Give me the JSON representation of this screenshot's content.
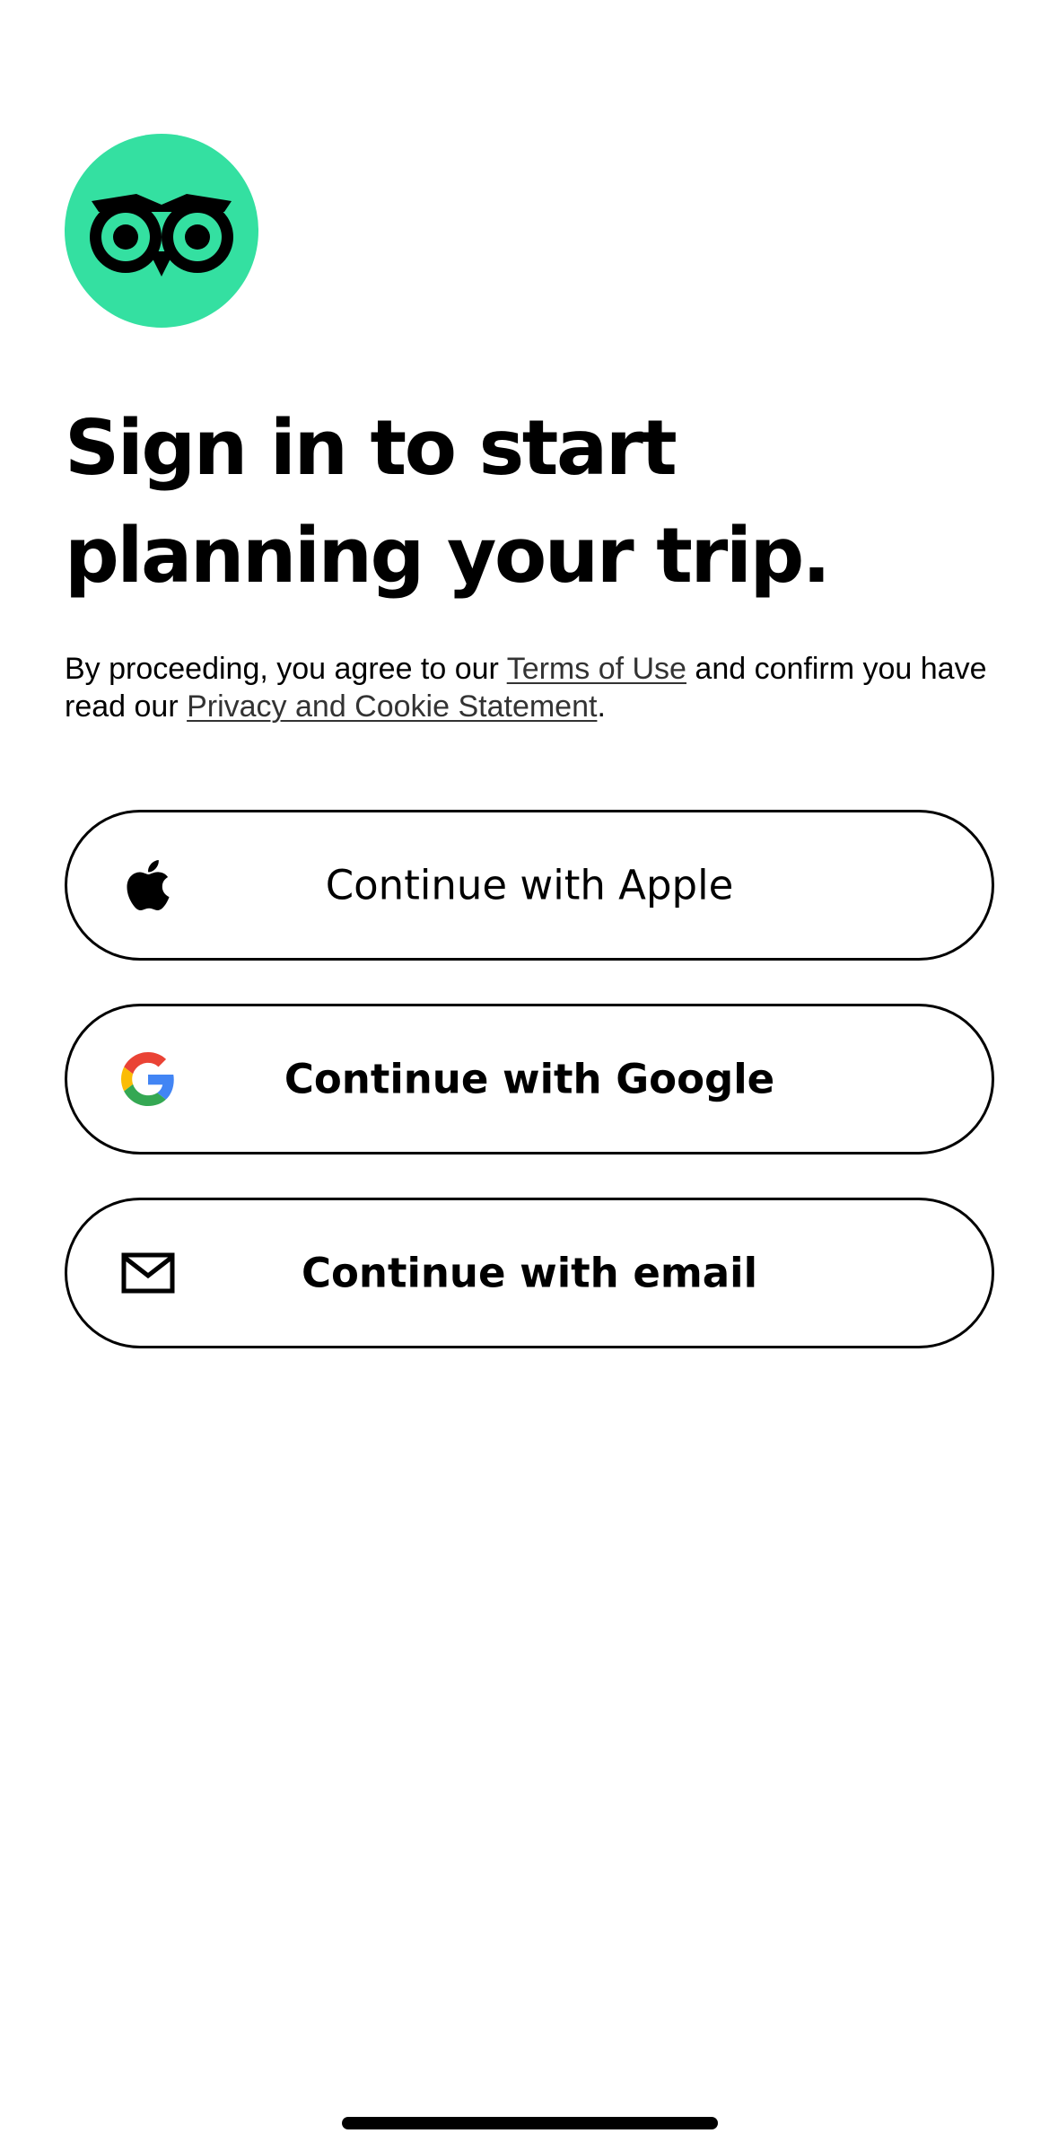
{
  "brand": {
    "logo_icon": "tripadvisor-owl-icon",
    "accent_color": "#34e0a1"
  },
  "headline": "Sign in to start planning your trip.",
  "legal": {
    "prefix": "By proceeding, you agree to our ",
    "terms_link": "Terms of Use",
    "middle": " and confirm you have read our ",
    "privacy_link": "Privacy and Cookie Statement",
    "suffix": "."
  },
  "buttons": {
    "apple": {
      "label": "Continue with Apple",
      "icon": "apple-icon"
    },
    "google": {
      "label": "Continue with Google",
      "icon": "google-icon"
    },
    "email": {
      "label": "Continue with email",
      "icon": "mail-icon"
    }
  }
}
